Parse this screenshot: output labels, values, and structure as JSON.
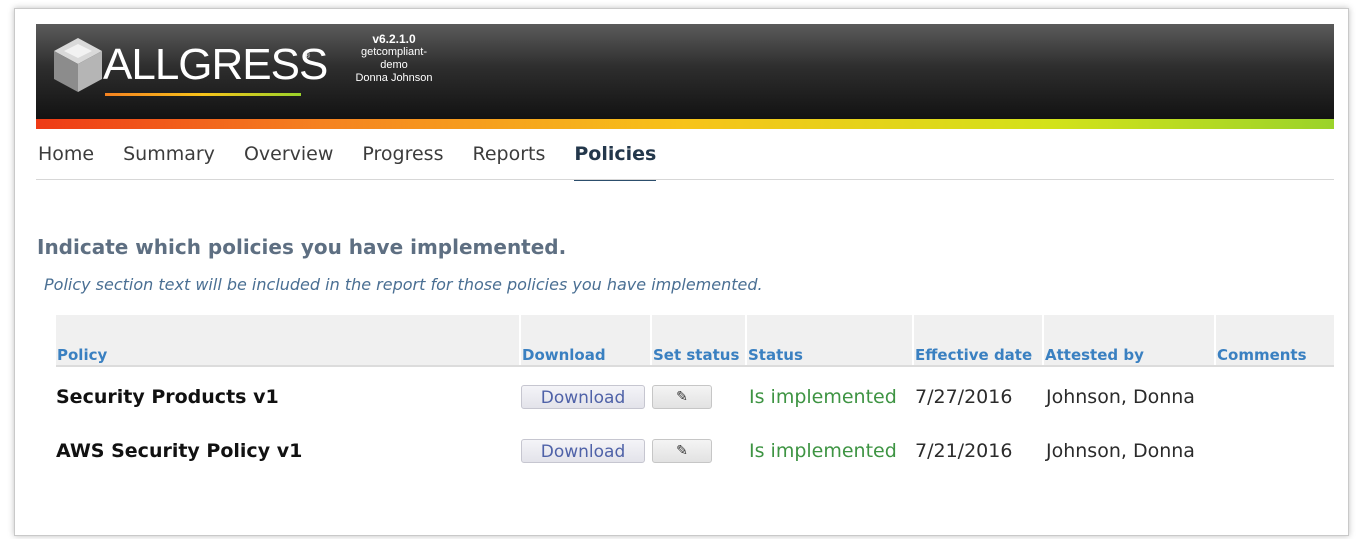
{
  "brand": {
    "logo_text": "ALLGRESS",
    "trademark": "®",
    "version": "v6.2.1.0",
    "instance_line1": "getcompliant-",
    "instance_line2": "demo",
    "user": "Donna Johnson",
    "colors": {
      "header_dark": "#121212",
      "stripe_start": "#ee3a16",
      "stripe_end": "#9bd32a"
    }
  },
  "nav": {
    "items": [
      {
        "label": "Home"
      },
      {
        "label": "Summary"
      },
      {
        "label": "Overview"
      },
      {
        "label": "Progress"
      },
      {
        "label": "Reports"
      },
      {
        "label": "Policies",
        "active": true
      }
    ]
  },
  "main": {
    "heading": "Indicate which policies you have implemented.",
    "subtext": "Policy section text will be included in the report for those policies you have implemented."
  },
  "table": {
    "columns": [
      "Policy",
      "Download",
      "Set status",
      "Status",
      "Effective date",
      "Attested by",
      "Comments"
    ],
    "rows": [
      {
        "policy": "Security Products v1",
        "download_label": "Download",
        "edit_icon": "pencil-icon",
        "status": "Is implemented",
        "effective_date": "7/27/2016",
        "attested_by": "Johnson, Donna",
        "comments": ""
      },
      {
        "policy": "AWS Security Policy v1",
        "download_label": "Download",
        "edit_icon": "pencil-icon",
        "status": "Is implemented",
        "effective_date": "7/21/2016",
        "attested_by": "Johnson, Donna",
        "comments": ""
      }
    ],
    "colors": {
      "header_text": "#3a80c1",
      "status_text": "#3e9443",
      "button_text": "#4f62a8"
    }
  }
}
